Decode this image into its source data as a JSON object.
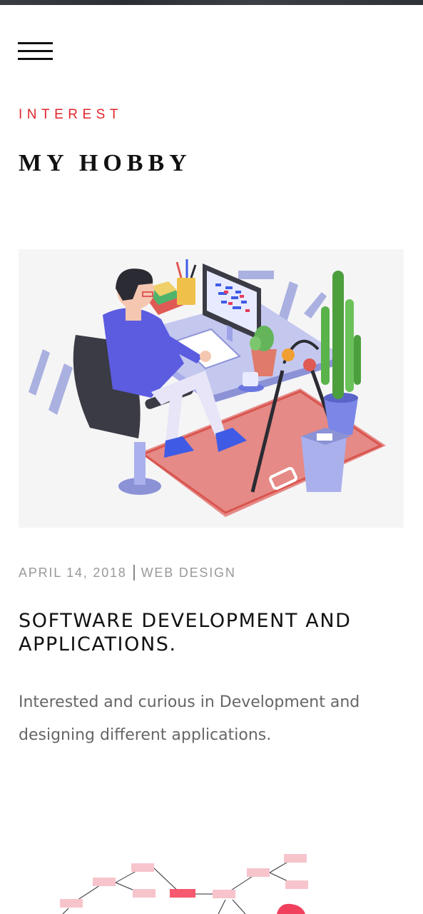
{
  "nav": {
    "menu_icon": "hamburger-menu-icon"
  },
  "section": {
    "label": "INTEREST",
    "title": "MY HOBBY"
  },
  "post": {
    "image_icon": "developer-at-desk-illustration",
    "date": "APRIL 14, 2018",
    "category": "WEB DESIGN",
    "title": "SOFTWARE DEVELOPMENT AND APPLICATIONS.",
    "excerpt": "Interested and curious in Development and designing different applications."
  },
  "next_post": {
    "image_icon": "network-diagram-illustration"
  },
  "colors": {
    "accent": "#e0262b",
    "text_dark": "#111111",
    "text_muted": "#999999",
    "body_text": "#666666"
  }
}
